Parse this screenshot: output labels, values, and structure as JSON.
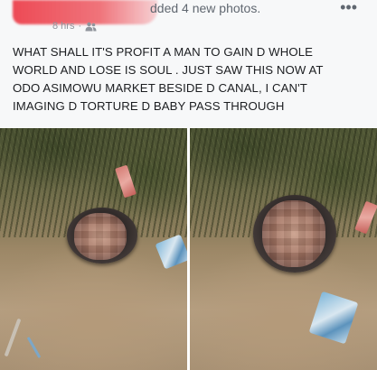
{
  "post": {
    "header_action": "dded 4 new photos.",
    "timestamp": "8 hrs",
    "meta_separator": "·",
    "audience_icon": "friends-icon",
    "more_label": "•••",
    "text": "WHAT SHALL IT'S PROFIT A MAN TO GAIN D WHOLE\nWORLD AND LOSE IS SOUL . JUST SAW THIS NOW AT\nODO ASIMOWU  MARKET BESIDE  D CANAL, I CAN'T\nIMAGING D TORTURE D BABY PASS THROUGH"
  },
  "colors": {
    "redaction": "#ec404c",
    "meta_text": "#90949c",
    "post_text": "#1c1e21"
  }
}
